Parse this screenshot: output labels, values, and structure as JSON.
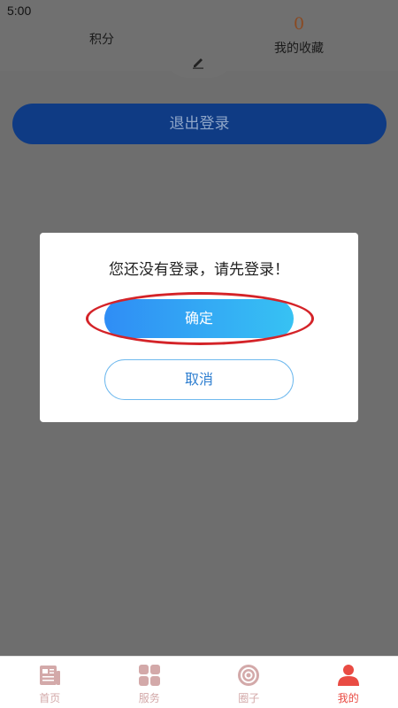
{
  "status": {
    "time": "5:00"
  },
  "stats": {
    "points_label": "积分",
    "favorites_count": "0",
    "favorites_label": "我的收藏"
  },
  "logout": {
    "label": "退出登录"
  },
  "dialog": {
    "message": "您还没有登录，请先登录！",
    "confirm_label": "确定",
    "cancel_label": "取消",
    "highlight_color": "#d42328"
  },
  "tabs": [
    {
      "label": "首页",
      "icon": "news-icon"
    },
    {
      "label": "服务",
      "icon": "grid-icon"
    },
    {
      "label": "圈子",
      "icon": "circle-icon"
    },
    {
      "label": "我的",
      "icon": "person-icon",
      "active": true
    }
  ],
  "colors": {
    "overlay": "#6e6e6e",
    "primary_button": "#0f3b84",
    "confirm_gradient_start": "#2f8df5",
    "confirm_gradient_end": "#37c2f3",
    "tab_active": "#e94b43",
    "tab_inactive": "#d3a9a9"
  }
}
